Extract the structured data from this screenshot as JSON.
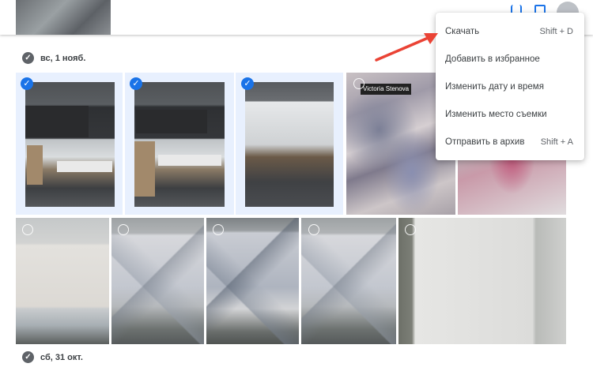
{
  "sections": [
    {
      "date_label": "вс, 1 нояб."
    },
    {
      "date_label": "сб, 31 окт."
    }
  ],
  "banner_text": "Victoria  Stenova",
  "context_menu": {
    "items": [
      {
        "label": "Скачать",
        "shortcut": "Shift + D"
      },
      {
        "label": "Добавить в избранное",
        "shortcut": ""
      },
      {
        "label": "Изменить дату и время",
        "shortcut": ""
      },
      {
        "label": "Изменить место съемки",
        "shortcut": ""
      },
      {
        "label": "Отправить в архив",
        "shortcut": "Shift + A"
      }
    ]
  },
  "selected_count_visual": 3,
  "colors": {
    "accent": "#1a73e8",
    "arrow": "#ea4335"
  },
  "check_glyph": "✓"
}
